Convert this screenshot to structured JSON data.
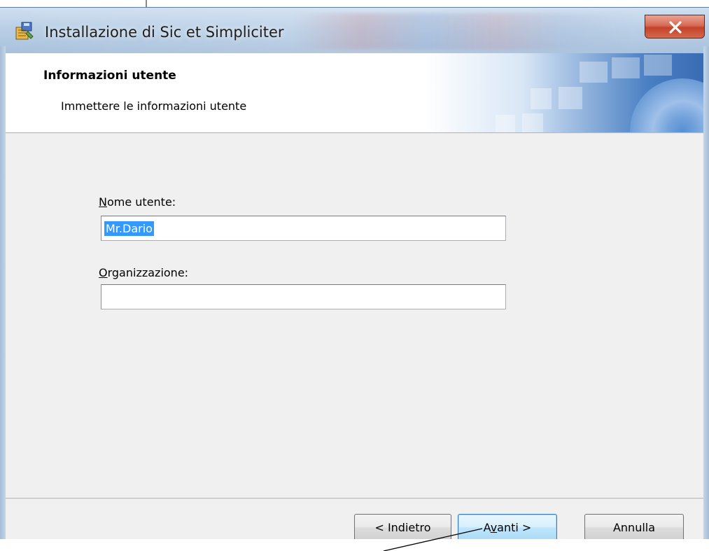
{
  "window": {
    "title": "Installazione di Sic et Simpliciter"
  },
  "banner": {
    "title": "Informazioni utente",
    "subtitle": "Immettere le informazioni utente"
  },
  "form": {
    "username": {
      "label_access_key": "N",
      "label_rest": "ome utente:",
      "value": "Mr.Dario"
    },
    "organization": {
      "label_access_key": "O",
      "label_rest": "rganizzazione:",
      "value": ""
    }
  },
  "buttons": {
    "back": "< Indietro",
    "next_prefix": "A",
    "next_access_key": "v",
    "next_suffix": "anti >",
    "cancel": "Annulla"
  },
  "colors": {
    "selection": "#3399ff",
    "close_button": "#c4422a",
    "default_button_border": "#3c7fb1"
  },
  "icons": {
    "app": "installer-package-icon",
    "close": "close-icon"
  }
}
